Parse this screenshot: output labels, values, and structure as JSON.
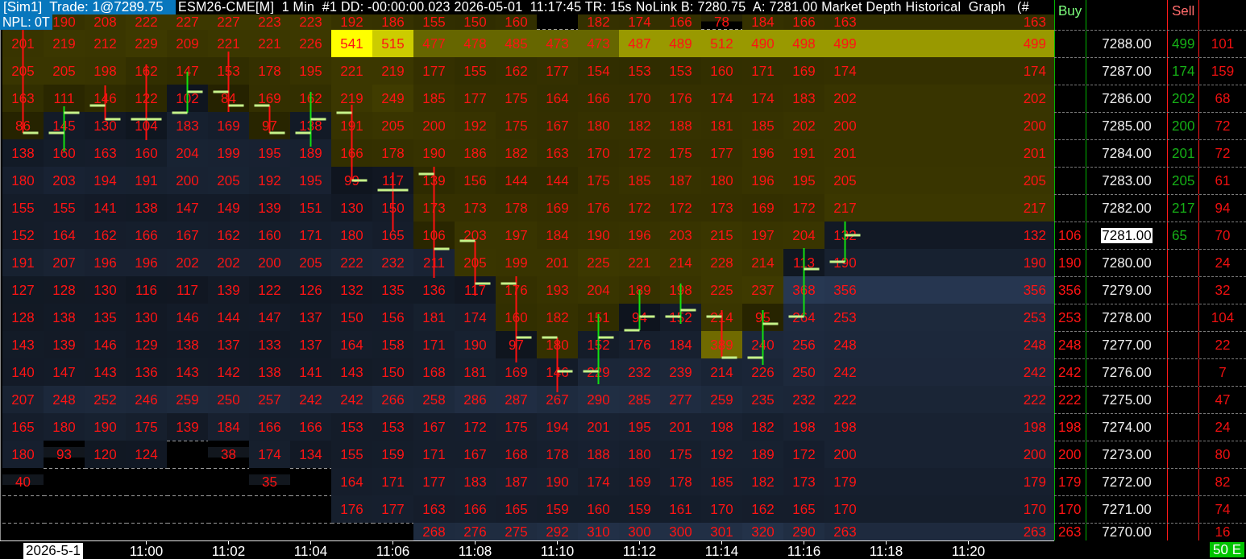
{
  "header": {
    "account_trade": "[Sim1]  Trade: 1@7289.75",
    "title": "ESM26-CME[M]  1 Min  #1 DD: -00:00:00.023 2026-05-01  11:17:45 TR: 15s NoLink B: 7280.75  A: 7281.00 Market Depth Historical  Graph   (#",
    "npl": "NPL: 0T"
  },
  "heatmap": {
    "rows": [
      {
        "cells": [
          {
            "kind": "empty"
          },
          {
            "value": "190",
            "kind": "ask"
          },
          {
            "value": "208",
            "kind": "ask"
          },
          {
            "value": "222",
            "kind": "ask"
          },
          {
            "value": "227",
            "kind": "ask"
          },
          {
            "value": "227",
            "kind": "ask"
          },
          {
            "value": "223",
            "kind": "ask"
          },
          {
            "value": "223",
            "kind": "ask"
          },
          {
            "value": "192",
            "kind": "ask"
          },
          {
            "value": "186",
            "kind": "ask"
          },
          {
            "value": "155",
            "kind": "ask"
          },
          {
            "value": "150",
            "kind": "ask"
          },
          {
            "value": "160",
            "kind": "ask"
          },
          {
            "kind": "empty"
          },
          {
            "value": "182",
            "kind": "ask"
          },
          {
            "value": "174",
            "kind": "ask"
          },
          {
            "value": "166",
            "kind": "ask"
          },
          {
            "value": "78",
            "kind": "thin"
          },
          {
            "value": "184",
            "kind": "ask"
          },
          {
            "value": "166",
            "kind": "ask"
          },
          {
            "value": "163",
            "kind": "ask"
          }
        ],
        "current": {
          "value": "163",
          "kind": "ask"
        }
      },
      {
        "cells": [
          {
            "value": "201",
            "kind": "ask"
          },
          {
            "value": "219",
            "kind": "ask"
          },
          {
            "value": "212",
            "kind": "ask"
          },
          {
            "value": "229",
            "kind": "ask"
          },
          {
            "value": "209",
            "kind": "ask"
          },
          {
            "value": "221",
            "kind": "ask"
          },
          {
            "value": "221",
            "kind": "ask"
          },
          {
            "value": "226",
            "kind": "ask"
          },
          {
            "value": "541",
            "kind": "ask"
          },
          {
            "value": "515",
            "kind": "ask"
          },
          {
            "value": "477",
            "kind": "ask"
          },
          {
            "value": "478",
            "kind": "ask"
          },
          {
            "value": "485",
            "kind": "ask"
          },
          {
            "value": "473",
            "kind": "ask"
          },
          {
            "value": "473",
            "kind": "ask"
          },
          {
            "value": "487",
            "kind": "ask"
          },
          {
            "value": "489",
            "kind": "ask"
          },
          {
            "value": "512",
            "kind": "ask"
          },
          {
            "value": "490",
            "kind": "ask"
          },
          {
            "value": "498",
            "kind": "ask"
          },
          {
            "value": "499",
            "kind": "ask"
          }
        ],
        "current": {
          "value": "499",
          "kind": "ask"
        }
      },
      {
        "cells": [
          {
            "value": "205",
            "kind": "ask"
          },
          {
            "value": "205",
            "kind": "ask"
          },
          {
            "value": "198",
            "kind": "ask"
          },
          {
            "value": "162",
            "kind": "ask"
          },
          {
            "value": "147",
            "kind": "ask"
          },
          {
            "value": "153",
            "kind": "ask"
          },
          {
            "value": "178",
            "kind": "ask"
          },
          {
            "value": "195",
            "kind": "ask"
          },
          {
            "value": "221",
            "kind": "ask"
          },
          {
            "value": "219",
            "kind": "ask"
          },
          {
            "value": "177",
            "kind": "ask"
          },
          {
            "value": "155",
            "kind": "ask"
          },
          {
            "value": "162",
            "kind": "ask"
          },
          {
            "value": "177",
            "kind": "ask"
          },
          {
            "value": "154",
            "kind": "ask"
          },
          {
            "value": "153",
            "kind": "ask"
          },
          {
            "value": "153",
            "kind": "ask"
          },
          {
            "value": "160",
            "kind": "ask"
          },
          {
            "value": "171",
            "kind": "ask"
          },
          {
            "value": "169",
            "kind": "ask"
          },
          {
            "value": "174",
            "kind": "ask"
          }
        ],
        "current": {
          "value": "174",
          "kind": "ask"
        }
      },
      {
        "cells": [
          {
            "value": "163",
            "kind": "ask"
          },
          {
            "value": "111",
            "kind": "ask"
          },
          {
            "value": "146",
            "kind": "ask"
          },
          {
            "value": "122",
            "kind": "ask"
          },
          {
            "value": "102",
            "kind": "bid"
          },
          {
            "value": "84",
            "kind": "ask"
          },
          {
            "value": "169",
            "kind": "ask"
          },
          {
            "value": "162",
            "kind": "ask"
          },
          {
            "value": "219",
            "kind": "ask"
          },
          {
            "value": "249",
            "kind": "ask"
          },
          {
            "value": "185",
            "kind": "ask"
          },
          {
            "value": "177",
            "kind": "ask"
          },
          {
            "value": "175",
            "kind": "ask"
          },
          {
            "value": "164",
            "kind": "ask"
          },
          {
            "value": "166",
            "kind": "ask"
          },
          {
            "value": "170",
            "kind": "ask"
          },
          {
            "value": "176",
            "kind": "ask"
          },
          {
            "value": "174",
            "kind": "ask"
          },
          {
            "value": "174",
            "kind": "ask"
          },
          {
            "value": "183",
            "kind": "ask"
          },
          {
            "value": "202",
            "kind": "ask"
          }
        ],
        "current": {
          "value": "202",
          "kind": "ask"
        }
      },
      {
        "cells": [
          {
            "value": "86",
            "kind": "ask"
          },
          {
            "value": "145",
            "kind": "bid"
          },
          {
            "value": "130",
            "kind": "bid"
          },
          {
            "value": "104",
            "kind": "bid"
          },
          {
            "value": "183",
            "kind": "bid"
          },
          {
            "value": "169",
            "kind": "bid"
          },
          {
            "value": "97",
            "kind": "ask"
          },
          {
            "value": "138",
            "kind": "bid"
          },
          {
            "value": "191",
            "kind": "ask"
          },
          {
            "value": "205",
            "kind": "ask"
          },
          {
            "value": "200",
            "kind": "ask"
          },
          {
            "value": "192",
            "kind": "ask"
          },
          {
            "value": "175",
            "kind": "ask"
          },
          {
            "value": "167",
            "kind": "ask"
          },
          {
            "value": "180",
            "kind": "ask"
          },
          {
            "value": "182",
            "kind": "ask"
          },
          {
            "value": "188",
            "kind": "ask"
          },
          {
            "value": "181",
            "kind": "ask"
          },
          {
            "value": "185",
            "kind": "ask"
          },
          {
            "value": "202",
            "kind": "ask"
          },
          {
            "value": "200",
            "kind": "ask"
          }
        ],
        "current": {
          "value": "200",
          "kind": "ask"
        }
      },
      {
        "cells": [
          {
            "value": "138",
            "kind": "bid"
          },
          {
            "value": "160",
            "kind": "bid"
          },
          {
            "value": "163",
            "kind": "bid"
          },
          {
            "value": "160",
            "kind": "bid"
          },
          {
            "value": "204",
            "kind": "bid"
          },
          {
            "value": "199",
            "kind": "bid"
          },
          {
            "value": "195",
            "kind": "bid"
          },
          {
            "value": "189",
            "kind": "bid"
          },
          {
            "value": "166",
            "kind": "ask"
          },
          {
            "value": "178",
            "kind": "ask"
          },
          {
            "value": "190",
            "kind": "ask"
          },
          {
            "value": "186",
            "kind": "ask"
          },
          {
            "value": "182",
            "kind": "ask"
          },
          {
            "value": "163",
            "kind": "ask"
          },
          {
            "value": "170",
            "kind": "ask"
          },
          {
            "value": "172",
            "kind": "ask"
          },
          {
            "value": "175",
            "kind": "ask"
          },
          {
            "value": "177",
            "kind": "ask"
          },
          {
            "value": "196",
            "kind": "ask"
          },
          {
            "value": "191",
            "kind": "ask"
          },
          {
            "value": "201",
            "kind": "ask"
          }
        ],
        "current": {
          "value": "201",
          "kind": "ask"
        }
      },
      {
        "cells": [
          {
            "value": "180",
            "kind": "bid"
          },
          {
            "value": "203",
            "kind": "bid"
          },
          {
            "value": "194",
            "kind": "bid"
          },
          {
            "value": "191",
            "kind": "bid"
          },
          {
            "value": "200",
            "kind": "bid"
          },
          {
            "value": "205",
            "kind": "bid"
          },
          {
            "value": "192",
            "kind": "bid"
          },
          {
            "value": "195",
            "kind": "bid"
          },
          {
            "value": "99",
            "kind": "bid"
          },
          {
            "value": "117",
            "kind": "bid"
          },
          {
            "value": "139",
            "kind": "ask"
          },
          {
            "value": "156",
            "kind": "ask"
          },
          {
            "value": "144",
            "kind": "ask"
          },
          {
            "value": "144",
            "kind": "ask"
          },
          {
            "value": "175",
            "kind": "ask"
          },
          {
            "value": "185",
            "kind": "ask"
          },
          {
            "value": "187",
            "kind": "ask"
          },
          {
            "value": "180",
            "kind": "ask"
          },
          {
            "value": "196",
            "kind": "ask"
          },
          {
            "value": "195",
            "kind": "ask"
          },
          {
            "value": "205",
            "kind": "ask"
          }
        ],
        "current": {
          "value": "205",
          "kind": "ask"
        }
      },
      {
        "cells": [
          {
            "value": "155",
            "kind": "bid"
          },
          {
            "value": "155",
            "kind": "bid"
          },
          {
            "value": "141",
            "kind": "bid"
          },
          {
            "value": "138",
            "kind": "bid"
          },
          {
            "value": "147",
            "kind": "bid"
          },
          {
            "value": "149",
            "kind": "bid"
          },
          {
            "value": "139",
            "kind": "bid"
          },
          {
            "value": "151",
            "kind": "bid"
          },
          {
            "value": "130",
            "kind": "bid"
          },
          {
            "value": "150",
            "kind": "bid"
          },
          {
            "value": "173",
            "kind": "ask"
          },
          {
            "value": "173",
            "kind": "ask"
          },
          {
            "value": "178",
            "kind": "ask"
          },
          {
            "value": "169",
            "kind": "ask"
          },
          {
            "value": "176",
            "kind": "ask"
          },
          {
            "value": "172",
            "kind": "ask"
          },
          {
            "value": "172",
            "kind": "ask"
          },
          {
            "value": "173",
            "kind": "ask"
          },
          {
            "value": "169",
            "kind": "ask"
          },
          {
            "value": "172",
            "kind": "ask"
          },
          {
            "value": "217",
            "kind": "ask"
          }
        ],
        "current": {
          "value": "217",
          "kind": "ask"
        }
      },
      {
        "cells": [
          {
            "value": "152",
            "kind": "bid"
          },
          {
            "value": "164",
            "kind": "bid"
          },
          {
            "value": "162",
            "kind": "bid"
          },
          {
            "value": "166",
            "kind": "bid"
          },
          {
            "value": "167",
            "kind": "bid"
          },
          {
            "value": "162",
            "kind": "bid"
          },
          {
            "value": "160",
            "kind": "bid"
          },
          {
            "value": "171",
            "kind": "bid"
          },
          {
            "value": "180",
            "kind": "bid"
          },
          {
            "value": "165",
            "kind": "bid"
          },
          {
            "value": "106",
            "kind": "ask"
          },
          {
            "value": "203",
            "kind": "ask"
          },
          {
            "value": "197",
            "kind": "ask"
          },
          {
            "value": "184",
            "kind": "ask"
          },
          {
            "value": "190",
            "kind": "ask"
          },
          {
            "value": "196",
            "kind": "ask"
          },
          {
            "value": "203",
            "kind": "ask"
          },
          {
            "value": "215",
            "kind": "ask"
          },
          {
            "value": "197",
            "kind": "ask"
          },
          {
            "value": "204",
            "kind": "ask"
          },
          {
            "value": "132",
            "kind": "bid"
          }
        ],
        "current": {
          "value": "132",
          "kind": "bid"
        }
      },
      {
        "cells": [
          {
            "value": "191",
            "kind": "bid"
          },
          {
            "value": "207",
            "kind": "bid"
          },
          {
            "value": "196",
            "kind": "bid"
          },
          {
            "value": "196",
            "kind": "bid"
          },
          {
            "value": "202",
            "kind": "bid"
          },
          {
            "value": "202",
            "kind": "bid"
          },
          {
            "value": "200",
            "kind": "bid"
          },
          {
            "value": "205",
            "kind": "bid"
          },
          {
            "value": "222",
            "kind": "bid"
          },
          {
            "value": "232",
            "kind": "bid"
          },
          {
            "value": "211",
            "kind": "bid"
          },
          {
            "value": "205",
            "kind": "ask"
          },
          {
            "value": "199",
            "kind": "ask"
          },
          {
            "value": "201",
            "kind": "ask"
          },
          {
            "value": "225",
            "kind": "ask"
          },
          {
            "value": "221",
            "kind": "ask"
          },
          {
            "value": "214",
            "kind": "ask"
          },
          {
            "value": "228",
            "kind": "ask"
          },
          {
            "value": "214",
            "kind": "ask"
          },
          {
            "value": "113",
            "kind": "bid"
          },
          {
            "value": "190",
            "kind": "bid"
          }
        ],
        "current": {
          "value": "190",
          "kind": "bid"
        }
      },
      {
        "cells": [
          {
            "value": "127",
            "kind": "bid"
          },
          {
            "value": "128",
            "kind": "bid"
          },
          {
            "value": "130",
            "kind": "bid"
          },
          {
            "value": "116",
            "kind": "bid"
          },
          {
            "value": "117",
            "kind": "bid"
          },
          {
            "value": "139",
            "kind": "bid"
          },
          {
            "value": "122",
            "kind": "bid"
          },
          {
            "value": "126",
            "kind": "bid"
          },
          {
            "value": "132",
            "kind": "bid"
          },
          {
            "value": "135",
            "kind": "bid"
          },
          {
            "value": "136",
            "kind": "bid"
          },
          {
            "value": "117",
            "kind": "bid"
          },
          {
            "value": "176",
            "kind": "ask"
          },
          {
            "value": "193",
            "kind": "ask"
          },
          {
            "value": "204",
            "kind": "ask"
          },
          {
            "value": "189",
            "kind": "ask"
          },
          {
            "value": "198",
            "kind": "ask"
          },
          {
            "value": "225",
            "kind": "ask"
          },
          {
            "value": "237",
            "kind": "ask"
          },
          {
            "value": "368",
            "kind": "bid"
          },
          {
            "value": "356",
            "kind": "bid"
          }
        ],
        "current": {
          "value": "356",
          "kind": "bid"
        }
      },
      {
        "cells": [
          {
            "value": "128",
            "kind": "bid"
          },
          {
            "value": "138",
            "kind": "bid"
          },
          {
            "value": "135",
            "kind": "bid"
          },
          {
            "value": "130",
            "kind": "bid"
          },
          {
            "value": "146",
            "kind": "bid"
          },
          {
            "value": "144",
            "kind": "bid"
          },
          {
            "value": "147",
            "kind": "bid"
          },
          {
            "value": "137",
            "kind": "bid"
          },
          {
            "value": "150",
            "kind": "bid"
          },
          {
            "value": "156",
            "kind": "bid"
          },
          {
            "value": "181",
            "kind": "bid"
          },
          {
            "value": "174",
            "kind": "bid"
          },
          {
            "value": "160",
            "kind": "ask"
          },
          {
            "value": "182",
            "kind": "ask"
          },
          {
            "value": "151",
            "kind": "ask"
          },
          {
            "value": "94",
            "kind": "bid"
          },
          {
            "value": "152",
            "kind": "bid"
          },
          {
            "value": "214",
            "kind": "ask"
          },
          {
            "value": "95",
            "kind": "ask"
          },
          {
            "value": "264",
            "kind": "bid"
          },
          {
            "value": "253",
            "kind": "bid"
          }
        ],
        "current": {
          "value": "253",
          "kind": "bid"
        }
      },
      {
        "cells": [
          {
            "value": "143",
            "kind": "bid"
          },
          {
            "value": "139",
            "kind": "bid"
          },
          {
            "value": "146",
            "kind": "bid"
          },
          {
            "value": "129",
            "kind": "bid"
          },
          {
            "value": "138",
            "kind": "bid"
          },
          {
            "value": "137",
            "kind": "bid"
          },
          {
            "value": "133",
            "kind": "bid"
          },
          {
            "value": "137",
            "kind": "bid"
          },
          {
            "value": "164",
            "kind": "bid"
          },
          {
            "value": "158",
            "kind": "bid"
          },
          {
            "value": "171",
            "kind": "bid"
          },
          {
            "value": "190",
            "kind": "bid"
          },
          {
            "value": "97",
            "kind": "bid"
          },
          {
            "value": "180",
            "kind": "ask"
          },
          {
            "value": "152",
            "kind": "bid"
          },
          {
            "value": "176",
            "kind": "bid"
          },
          {
            "value": "184",
            "kind": "bid"
          },
          {
            "value": "389",
            "kind": "ask"
          },
          {
            "value": "240",
            "kind": "bid"
          },
          {
            "value": "256",
            "kind": "bid"
          },
          {
            "value": "248",
            "kind": "bid"
          }
        ],
        "current": {
          "value": "248",
          "kind": "bid"
        }
      },
      {
        "cells": [
          {
            "value": "140",
            "kind": "bid"
          },
          {
            "value": "147",
            "kind": "bid"
          },
          {
            "value": "143",
            "kind": "bid"
          },
          {
            "value": "136",
            "kind": "bid"
          },
          {
            "value": "143",
            "kind": "bid"
          },
          {
            "value": "142",
            "kind": "bid"
          },
          {
            "value": "138",
            "kind": "bid"
          },
          {
            "value": "141",
            "kind": "bid"
          },
          {
            "value": "143",
            "kind": "bid"
          },
          {
            "value": "150",
            "kind": "bid"
          },
          {
            "value": "168",
            "kind": "bid"
          },
          {
            "value": "181",
            "kind": "bid"
          },
          {
            "value": "169",
            "kind": "bid"
          },
          {
            "value": "146",
            "kind": "bid"
          },
          {
            "value": "229",
            "kind": "bid"
          },
          {
            "value": "232",
            "kind": "bid"
          },
          {
            "value": "239",
            "kind": "bid"
          },
          {
            "value": "214",
            "kind": "bid"
          },
          {
            "value": "226",
            "kind": "bid"
          },
          {
            "value": "250",
            "kind": "bid"
          },
          {
            "value": "242",
            "kind": "bid"
          }
        ],
        "current": {
          "value": "242",
          "kind": "bid"
        }
      },
      {
        "cells": [
          {
            "value": "207",
            "kind": "bid"
          },
          {
            "value": "248",
            "kind": "bid"
          },
          {
            "value": "252",
            "kind": "bid"
          },
          {
            "value": "246",
            "kind": "bid"
          },
          {
            "value": "259",
            "kind": "bid"
          },
          {
            "value": "250",
            "kind": "bid"
          },
          {
            "value": "257",
            "kind": "bid"
          },
          {
            "value": "242",
            "kind": "bid"
          },
          {
            "value": "242",
            "kind": "bid"
          },
          {
            "value": "266",
            "kind": "bid"
          },
          {
            "value": "258",
            "kind": "bid"
          },
          {
            "value": "286",
            "kind": "bid"
          },
          {
            "value": "287",
            "kind": "bid"
          },
          {
            "value": "267",
            "kind": "bid"
          },
          {
            "value": "290",
            "kind": "bid"
          },
          {
            "value": "285",
            "kind": "bid"
          },
          {
            "value": "277",
            "kind": "bid"
          },
          {
            "value": "259",
            "kind": "bid"
          },
          {
            "value": "235",
            "kind": "bid"
          },
          {
            "value": "232",
            "kind": "bid"
          },
          {
            "value": "222",
            "kind": "bid"
          }
        ],
        "current": {
          "value": "222",
          "kind": "bid"
        }
      },
      {
        "cells": [
          {
            "value": "165",
            "kind": "bid"
          },
          {
            "value": "180",
            "kind": "bid"
          },
          {
            "value": "190",
            "kind": "bid"
          },
          {
            "value": "175",
            "kind": "bid"
          },
          {
            "value": "139",
            "kind": "bid"
          },
          {
            "value": "184",
            "kind": "bid"
          },
          {
            "value": "166",
            "kind": "bid"
          },
          {
            "value": "166",
            "kind": "bid"
          },
          {
            "value": "153",
            "kind": "bid"
          },
          {
            "value": "153",
            "kind": "bid"
          },
          {
            "value": "167",
            "kind": "bid"
          },
          {
            "value": "172",
            "kind": "bid"
          },
          {
            "value": "175",
            "kind": "bid"
          },
          {
            "value": "194",
            "kind": "bid"
          },
          {
            "value": "201",
            "kind": "bid"
          },
          {
            "value": "195",
            "kind": "bid"
          },
          {
            "value": "201",
            "kind": "bid"
          },
          {
            "value": "198",
            "kind": "bid"
          },
          {
            "value": "182",
            "kind": "bid"
          },
          {
            "value": "198",
            "kind": "bid"
          },
          {
            "value": "198",
            "kind": "bid"
          }
        ],
        "current": {
          "value": "198",
          "kind": "bid"
        }
      },
      {
        "cells": [
          {
            "value": "180",
            "kind": "bid"
          },
          {
            "value": "93",
            "kind": "thin"
          },
          {
            "value": "120",
            "kind": "bid"
          },
          {
            "value": "124",
            "kind": "bid"
          },
          {
            "kind": "empty"
          },
          {
            "value": "38",
            "kind": "thin"
          },
          {
            "value": "174",
            "kind": "bid"
          },
          {
            "value": "134",
            "kind": "bid"
          },
          {
            "value": "155",
            "kind": "bid"
          },
          {
            "value": "159",
            "kind": "bid"
          },
          {
            "value": "171",
            "kind": "bid"
          },
          {
            "value": "167",
            "kind": "bid"
          },
          {
            "value": "168",
            "kind": "bid"
          },
          {
            "value": "178",
            "kind": "bid"
          },
          {
            "value": "188",
            "kind": "bid"
          },
          {
            "value": "180",
            "kind": "bid"
          },
          {
            "value": "175",
            "kind": "bid"
          },
          {
            "value": "192",
            "kind": "bid"
          },
          {
            "value": "189",
            "kind": "bid"
          },
          {
            "value": "172",
            "kind": "bid"
          },
          {
            "value": "200",
            "kind": "bid"
          }
        ],
        "current": {
          "value": "200",
          "kind": "bid"
        }
      },
      {
        "cells": [
          {
            "value": "40",
            "kind": "thin"
          },
          {
            "kind": "empty"
          },
          {
            "kind": "empty"
          },
          {
            "kind": "empty"
          },
          {
            "kind": "empty"
          },
          {
            "kind": "empty"
          },
          {
            "value": "35",
            "kind": "thin"
          },
          {
            "kind": "empty"
          },
          {
            "value": "164",
            "kind": "bid"
          },
          {
            "value": "171",
            "kind": "bid"
          },
          {
            "value": "177",
            "kind": "bid"
          },
          {
            "value": "183",
            "kind": "bid"
          },
          {
            "value": "187",
            "kind": "bid"
          },
          {
            "value": "190",
            "kind": "bid"
          },
          {
            "value": "174",
            "kind": "bid"
          },
          {
            "value": "169",
            "kind": "bid"
          },
          {
            "value": "178",
            "kind": "bid"
          },
          {
            "value": "185",
            "kind": "bid"
          },
          {
            "value": "182",
            "kind": "bid"
          },
          {
            "value": "173",
            "kind": "bid"
          },
          {
            "value": "179",
            "kind": "bid"
          }
        ],
        "current": {
          "value": "179",
          "kind": "bid"
        }
      },
      {
        "cells": [
          {
            "kind": "empty"
          },
          {
            "kind": "empty"
          },
          {
            "kind": "empty"
          },
          {
            "kind": "empty"
          },
          {
            "kind": "empty"
          },
          {
            "kind": "empty"
          },
          {
            "kind": "empty"
          },
          {
            "kind": "empty"
          },
          {
            "value": "176",
            "kind": "bid"
          },
          {
            "value": "177",
            "kind": "bid"
          },
          {
            "value": "163",
            "kind": "bid"
          },
          {
            "value": "166",
            "kind": "bid"
          },
          {
            "value": "165",
            "kind": "bid"
          },
          {
            "value": "159",
            "kind": "bid"
          },
          {
            "value": "160",
            "kind": "bid"
          },
          {
            "value": "159",
            "kind": "bid"
          },
          {
            "value": "161",
            "kind": "bid"
          },
          {
            "value": "170",
            "kind": "bid"
          },
          {
            "value": "162",
            "kind": "bid"
          },
          {
            "value": "165",
            "kind": "bid"
          },
          {
            "value": "170",
            "kind": "bid"
          }
        ],
        "current": {
          "value": "170",
          "kind": "bid"
        }
      },
      {
        "cells": [
          {
            "kind": "empty"
          },
          {
            "kind": "empty"
          },
          {
            "kind": "empty"
          },
          {
            "kind": "empty"
          },
          {
            "kind": "empty"
          },
          {
            "kind": "empty"
          },
          {
            "kind": "empty"
          },
          {
            "kind": "empty"
          },
          {
            "kind": "empty"
          },
          {
            "kind": "empty"
          },
          {
            "value": "268",
            "kind": "bid"
          },
          {
            "value": "276",
            "kind": "bid"
          },
          {
            "value": "275",
            "kind": "bid"
          },
          {
            "value": "292",
            "kind": "bid"
          },
          {
            "value": "310",
            "kind": "bid"
          },
          {
            "value": "300",
            "kind": "bid"
          },
          {
            "value": "300",
            "kind": "bid"
          },
          {
            "value": "301",
            "kind": "bid"
          },
          {
            "value": "320",
            "kind": "bid"
          },
          {
            "value": "290",
            "kind": "bid"
          },
          {
            "value": "263",
            "kind": "bid"
          }
        ],
        "current": {
          "value": "263",
          "kind": "bid"
        }
      }
    ]
  },
  "ladder": {
    "buy_header": "Buy",
    "sell_header": "Sell",
    "rows": [
      {
        "price": "7288.00",
        "sell": "499",
        "column_4": "101",
        "selected": false
      },
      {
        "price": "7287.00",
        "sell": "174",
        "column_4": "159",
        "selected": false
      },
      {
        "price": "7286.00",
        "sell": "202",
        "column_4": "68",
        "selected": false
      },
      {
        "price": "7285.00",
        "sell": "200",
        "column_4": "72",
        "selected": false
      },
      {
        "price": "7284.00",
        "sell": "201",
        "column_4": "72",
        "selected": false
      },
      {
        "price": "7283.00",
        "sell": "205",
        "column_4": "61",
        "selected": false
      },
      {
        "price": "7282.00",
        "sell": "217",
        "column_4": "94",
        "selected": false
      },
      {
        "buy": "106",
        "price": "7281.00",
        "sell": "65",
        "column_4": "70",
        "selected": true
      },
      {
        "buy": "190",
        "price": "7280.00",
        "column_4": "24",
        "selected": false
      },
      {
        "buy": "356",
        "price": "7279.00",
        "column_4": "32",
        "selected": false
      },
      {
        "buy": "253",
        "price": "7278.00",
        "column_4": "104",
        "selected": false
      },
      {
        "buy": "248",
        "price": "7277.00",
        "column_4": "22",
        "selected": false
      },
      {
        "buy": "242",
        "price": "7276.00",
        "column_4": "7",
        "selected": false
      },
      {
        "buy": "222",
        "price": "7275.00",
        "column_4": "47",
        "selected": false
      },
      {
        "buy": "198",
        "price": "7274.00",
        "column_4": "24",
        "selected": false
      },
      {
        "buy": "200",
        "price": "7273.00",
        "column_4": "80",
        "selected": false
      },
      {
        "buy": "179",
        "price": "7272.00",
        "column_4": "82",
        "selected": false
      },
      {
        "buy": "170",
        "price": "7271.00",
        "column_4": "74",
        "selected": false
      },
      {
        "buy": "263",
        "price": "7270.00",
        "column_4": "16",
        "selected": false
      }
    ]
  },
  "time_axis": {
    "date": "2026-5-1",
    "labels": [
      "11:00",
      "11:02",
      "11:04",
      "11:06",
      "11:08",
      "11:10",
      "11:12",
      "11:14",
      "11:16",
      "11:18",
      "11:20"
    ]
  },
  "status_badge": "50 E"
}
